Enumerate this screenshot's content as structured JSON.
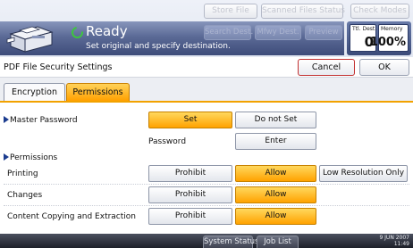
{
  "header": {
    "store_file": "Store File",
    "scanned_files_status": "Scanned Files Status",
    "check_modes": "Check Modes",
    "ready": "Ready",
    "instruction": "Set original and specify destination.",
    "search_dest": "Search Dest.",
    "mfwy_dest": "Mfwy Dest.",
    "preview": "Preview",
    "ttl_dest_label": "Ttl. Dest.",
    "ttl_dest_value": "0",
    "memory_label": "Memory",
    "memory_value": "100%"
  },
  "titlebar": {
    "title": "PDF File Security Settings",
    "cancel": "Cancel",
    "ok": "OK"
  },
  "tabs": [
    {
      "label": "Encryption",
      "active": false
    },
    {
      "label": "Permissions",
      "active": true
    }
  ],
  "master_password": {
    "label": "Master Password",
    "set": "Set",
    "do_not_set": "Do not Set",
    "selected": "Set",
    "password_label": "Password",
    "enter": "Enter"
  },
  "permissions": {
    "heading": "Permissions",
    "rows": [
      {
        "label": "Printing",
        "prohibit": "Prohibit",
        "allow": "Allow",
        "low_res": "Low Resolution Only",
        "selected": "Allow"
      },
      {
        "label": "Changes",
        "prohibit": "Prohibit",
        "allow": "Allow",
        "selected": "Allow"
      },
      {
        "label": "Content Copying and Extraction",
        "prohibit": "Prohibit",
        "allow": "Allow",
        "selected": "Allow"
      }
    ]
  },
  "bottombar": {
    "system_status": "System Status",
    "job_list": "Job List",
    "date": "9 JUN 2007",
    "time": "11:49"
  },
  "colors": {
    "accent_selected": "#ffb000",
    "header_blue": "#4a5a88",
    "cancel_border": "#c23030",
    "ready_green": "#3ec63e"
  }
}
